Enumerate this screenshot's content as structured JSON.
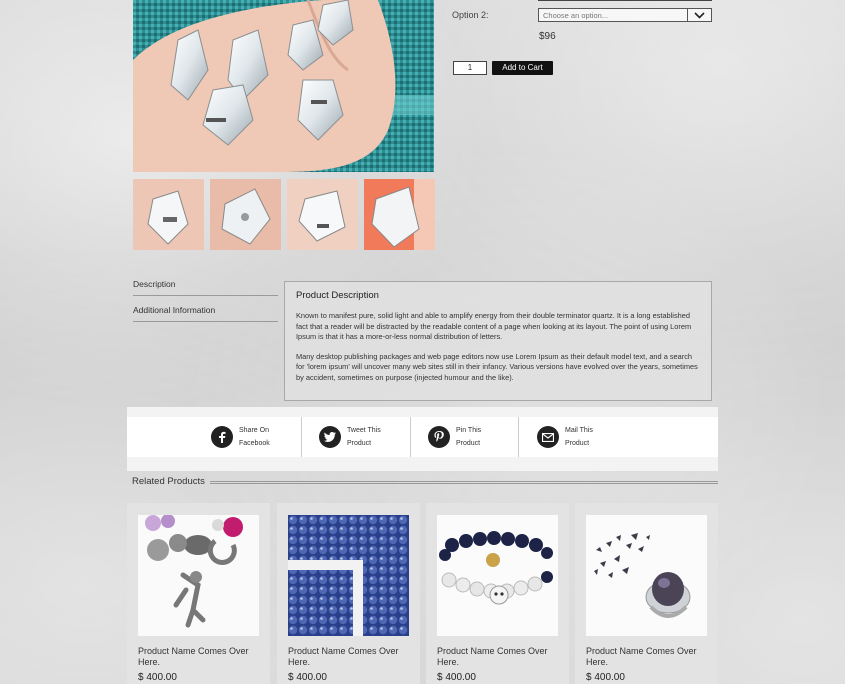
{
  "product": {
    "option_label": "Option 2:",
    "option_placeholder": "Choose an option...",
    "price": "$96",
    "quantity": "1",
    "add_to_cart": "Add to Cart"
  },
  "tabs": {
    "description": "Description",
    "additional": "Additional Information"
  },
  "description": {
    "title": "Product Description",
    "para1": "Known to manifest pure, solid light and able to amplify energy from their double terminator quartz. It is a long established fact that a reader will be distracted by the readable content of a page when looking at its layout. The point of using Lorem Ipsum is that it has a more-or-less normal distribution of letters.",
    "para2": "Many desktop publishing packages and web page editors now use Lorem Ipsum as their default model text, and a search for 'lorem ipsum' will uncover many web sites still in their infancy. Various versions have evolved over the years, sometimes by accident, sometimes on purpose (injected humour and the like)."
  },
  "share": {
    "facebook_1": "Share On",
    "facebook_2": "Facebook",
    "twitter_1": "Tweet This",
    "twitter_2": "Product",
    "pinterest_1": "Pin This",
    "pinterest_2": "Product",
    "mail_1": "Mail This",
    "mail_2": "Product"
  },
  "related": {
    "title": "Related Products",
    "items": [
      {
        "name": "Product Name Comes Over Here.",
        "price": "$ 400.00"
      },
      {
        "name": "Product Name Comes Over Here.",
        "price": "$ 400.00"
      },
      {
        "name": "Product Name Comes Over Here.",
        "price": "$ 400.00"
      },
      {
        "name": "Product Name Comes Over Here.",
        "price": "$ 400.00"
      }
    ]
  },
  "icons": [
    "facebook-icon",
    "twitter-icon",
    "pinterest-icon",
    "mail-icon",
    "chevron-down-icon"
  ]
}
